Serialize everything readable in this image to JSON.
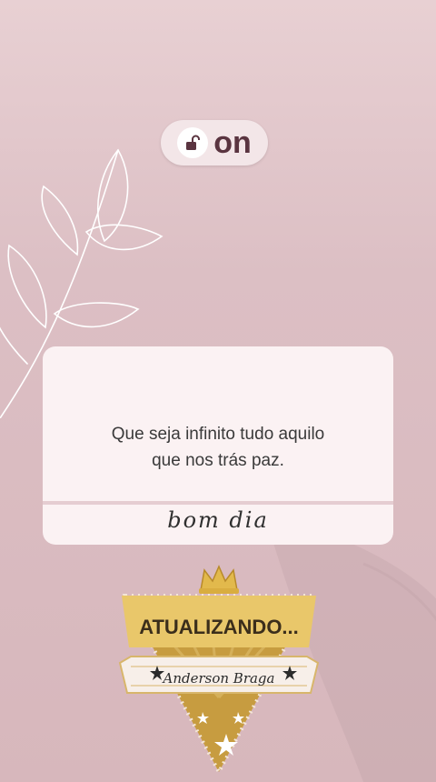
{
  "status_pill": {
    "label": "on",
    "icon": "unlock-icon"
  },
  "card": {
    "quote_line1": "Que seja infinito tudo aquilo",
    "quote_line2": "que nos trás paz.",
    "signature": "bom dia"
  },
  "badge": {
    "title": "ATUALIZANDO...",
    "name": "Anderson Braga"
  },
  "colors": {
    "background": "#dcbfc4",
    "card": "#fbf2f3",
    "gold": "#c9a246",
    "dark": "#3b2e1b"
  }
}
